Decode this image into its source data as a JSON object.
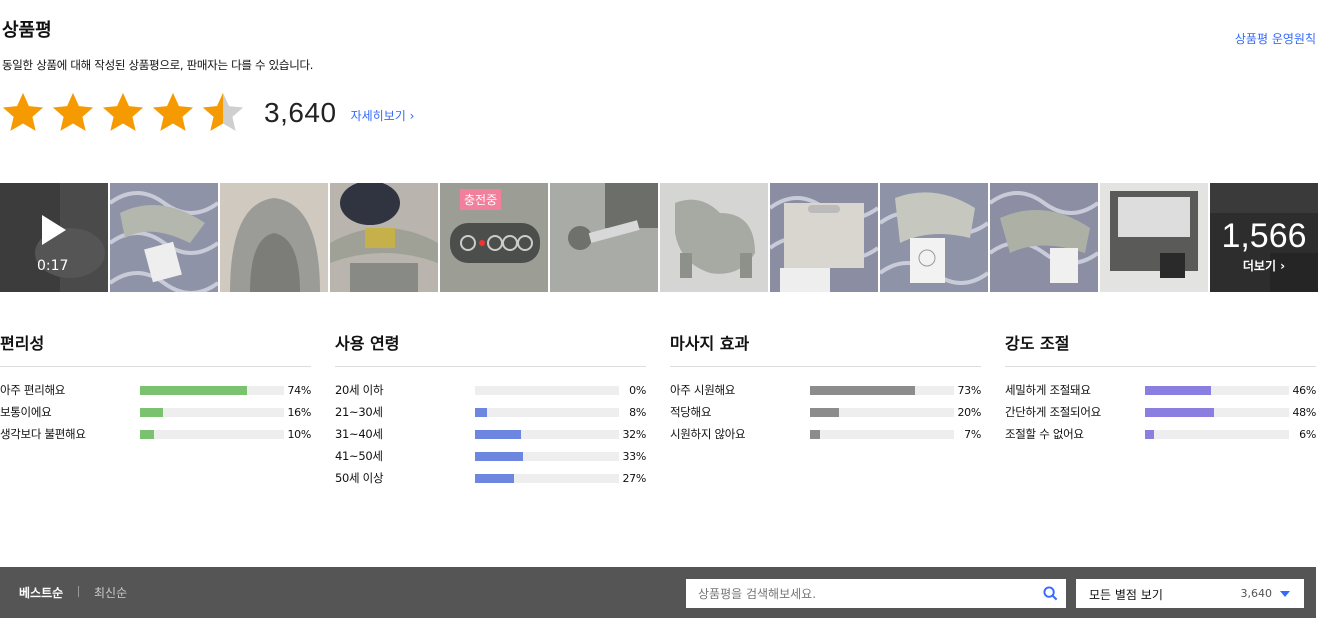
{
  "header": {
    "title": "상품평",
    "policy_link": "상품평 운영원칙",
    "subtitle": "동일한 상품에 대해 작성된 상품평으로, 판매자는 다를 수 있습니다."
  },
  "rating": {
    "stars": 4.5,
    "count": "3,640",
    "detail_link": "자세히보기 ›"
  },
  "gallery": {
    "video_duration": "0:17",
    "charging_badge": "충전중",
    "more_count": "1,566",
    "more_label": "더보기 ›"
  },
  "stats": [
    {
      "title": "편리성",
      "color": "#7ac170",
      "rows": [
        {
          "label": "아주 편리해요",
          "pct": "74%",
          "value": 74
        },
        {
          "label": "보통이에요",
          "pct": "16%",
          "value": 16
        },
        {
          "label": "생각보다 불편해요",
          "pct": "10%",
          "value": 10
        }
      ]
    },
    {
      "title": "사용 연령",
      "color": "#6d87e0",
      "rows": [
        {
          "label": "20세 이하",
          "pct": "0%",
          "value": 0
        },
        {
          "label": "21~30세",
          "pct": "8%",
          "value": 8
        },
        {
          "label": "31~40세",
          "pct": "32%",
          "value": 32
        },
        {
          "label": "41~50세",
          "pct": "33%",
          "value": 33
        },
        {
          "label": "50세 이상",
          "pct": "27%",
          "value": 27
        }
      ]
    },
    {
      "title": "마사지 효과",
      "color": "#8c8c8c",
      "rows": [
        {
          "label": "아주 시원해요",
          "pct": "73%",
          "value": 73
        },
        {
          "label": "적당해요",
          "pct": "20%",
          "value": 20
        },
        {
          "label": "시원하지 않아요",
          "pct": "7%",
          "value": 7
        }
      ]
    },
    {
      "title": "강도 조절",
      "color": "#8a7ee0",
      "rows": [
        {
          "label": "세밀하게 조절돼요",
          "pct": "46%",
          "value": 46
        },
        {
          "label": "간단하게 조절되어요",
          "pct": "48%",
          "value": 48
        },
        {
          "label": "조절할 수 없어요",
          "pct": "6%",
          "value": 6
        }
      ]
    }
  ],
  "toolbar": {
    "sort_best": "베스트순",
    "sort_recent": "최신순",
    "search_placeholder": "상품평을 검색해보세요.",
    "filter_label": "모든 별점 보기",
    "filter_count": "3,640"
  }
}
